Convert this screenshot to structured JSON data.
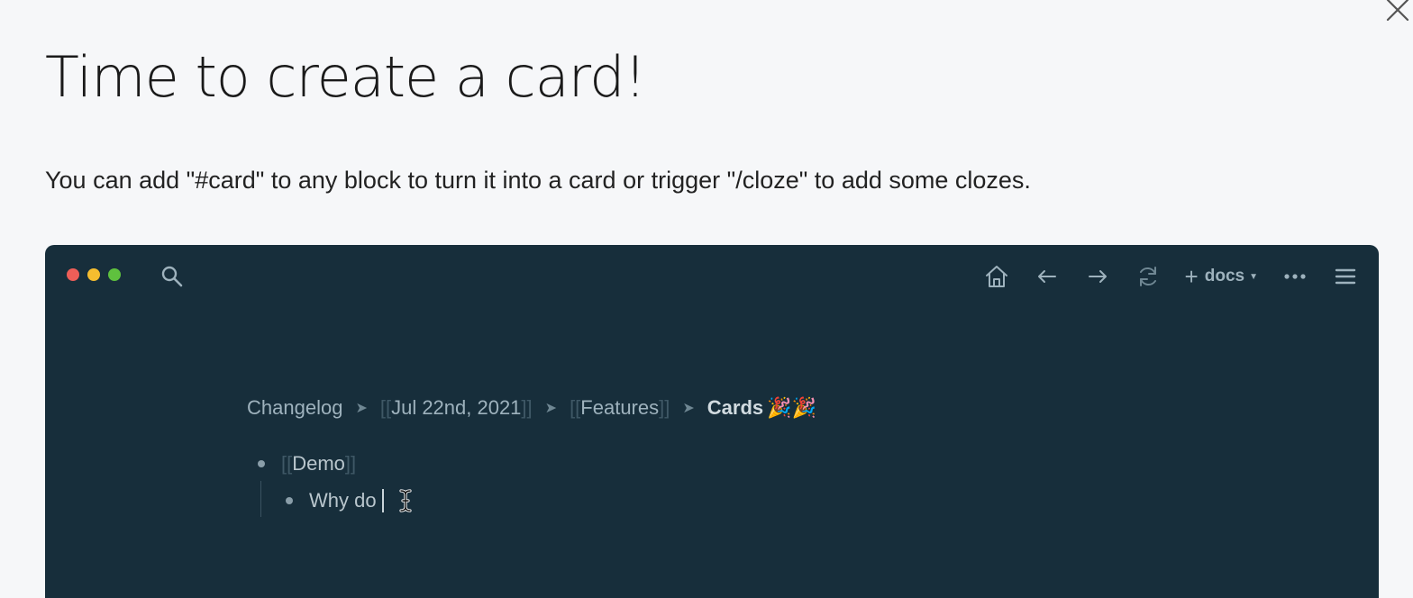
{
  "modal": {
    "title": "Time to create a card!",
    "description": "You can add \"#card\" to any block to turn it into a card or trigger \"/cloze\" to add some clozes.",
    "close_icon": "close-icon"
  },
  "preview": {
    "window_controls": [
      "close",
      "minimize",
      "maximize"
    ],
    "toolbar": {
      "icons": [
        "search-icon",
        "home-icon",
        "arrow-left-icon",
        "arrow-right-icon",
        "refresh-icon",
        "more-icon",
        "menu-icon"
      ],
      "add_label": "+",
      "graph_label": "docs"
    },
    "breadcrumb": {
      "items": [
        "Changelog",
        "Jul 22nd, 2021",
        "Features"
      ],
      "current": "Cards",
      "current_emoji": "🎉🎉",
      "bracket_open": "[[",
      "bracket_close": "]]"
    },
    "blocks": [
      {
        "text": "Demo",
        "is_page_ref": true
      },
      {
        "text": "Why do"
      }
    ]
  },
  "colors": {
    "page_bg": "#f6f7f9",
    "preview_bg": "#172e3b",
    "dot_red": "#ed5e58",
    "dot_yellow": "#f5bd2f",
    "dot_green": "#5fc13e"
  }
}
